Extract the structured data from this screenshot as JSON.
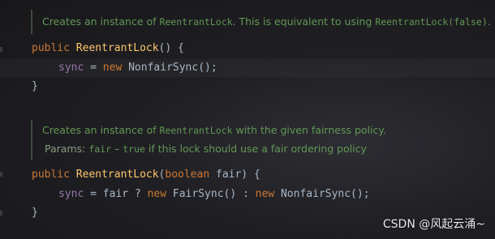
{
  "block1": {
    "doc": {
      "prefix": "Creates an instance of ",
      "class_ref": "ReentrantLock",
      "middle": ". This is equivalent to using ",
      "call_ref": "ReentrantLock(false)",
      "suffix": "."
    },
    "sig": {
      "kw": "public",
      "name": "ReentrantLock",
      "rest": "() {"
    },
    "body": {
      "field": "sync",
      "op": " = ",
      "kw": "new",
      "rest": " NonfairSync();"
    },
    "close": "}"
  },
  "block2": {
    "doc": {
      "prefix": "Creates an instance of ",
      "class_ref": "ReentrantLock",
      "suffix": " with the given fairness policy.",
      "params_label": "Params: ",
      "param_name": "fair",
      "dash": " – ",
      "param_true": "true",
      "param_desc": " if this lock should use a fair ordering policy"
    },
    "sig": {
      "kw": "public",
      "name": "ReentrantLock",
      "open": "(",
      "type": "boolean",
      "rest": " fair) {"
    },
    "body": {
      "field": "sync",
      "mid": " = fair ? ",
      "kw1": "new",
      "mid2": " FairSync() : ",
      "kw2": "new",
      "rest": " NonfairSync();"
    },
    "close": "}"
  },
  "watermark": "CSDN @风起云涌~"
}
